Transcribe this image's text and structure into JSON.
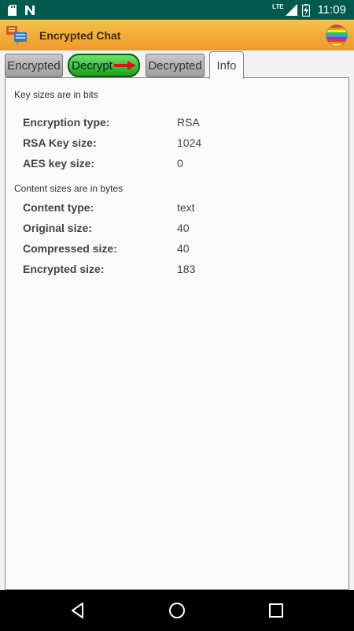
{
  "status_bar": {
    "time": "11:09",
    "network": "LTE",
    "icons": [
      "sd-card-icon",
      "n-notification-icon",
      "signal-icon",
      "battery-charging-icon"
    ]
  },
  "app_bar": {
    "title": "Encrypted Chat",
    "icons": [
      "app-logo-icon",
      "rainbow-ball-icon"
    ]
  },
  "tabs": [
    {
      "label": "Encrypted"
    },
    {
      "label": "Decrypt"
    },
    {
      "label": "Decrypted"
    },
    {
      "label": "Info"
    }
  ],
  "info": {
    "key_note": "Key sizes are in bits",
    "key_rows": [
      {
        "label": "Encryption type:",
        "value": "RSA"
      },
      {
        "label": "RSA Key size:",
        "value": "1024"
      },
      {
        "label": "AES key size:",
        "value": "0"
      }
    ],
    "content_note": "Content sizes are in bytes",
    "content_rows": [
      {
        "label": "Content type:",
        "value": "text"
      },
      {
        "label": "Original size:",
        "value": "40"
      },
      {
        "label": "Compressed size:",
        "value": "40"
      },
      {
        "label": "Encrypted size:",
        "value": "183"
      }
    ]
  },
  "nav_bar": {
    "icons": [
      "back-icon",
      "home-icon",
      "recents-icon"
    ]
  },
  "colors": {
    "status_bar": "#00594d",
    "app_bar": "#f0a030",
    "decrypt_tab": "#2eb82e",
    "arrow": "#e11111"
  }
}
